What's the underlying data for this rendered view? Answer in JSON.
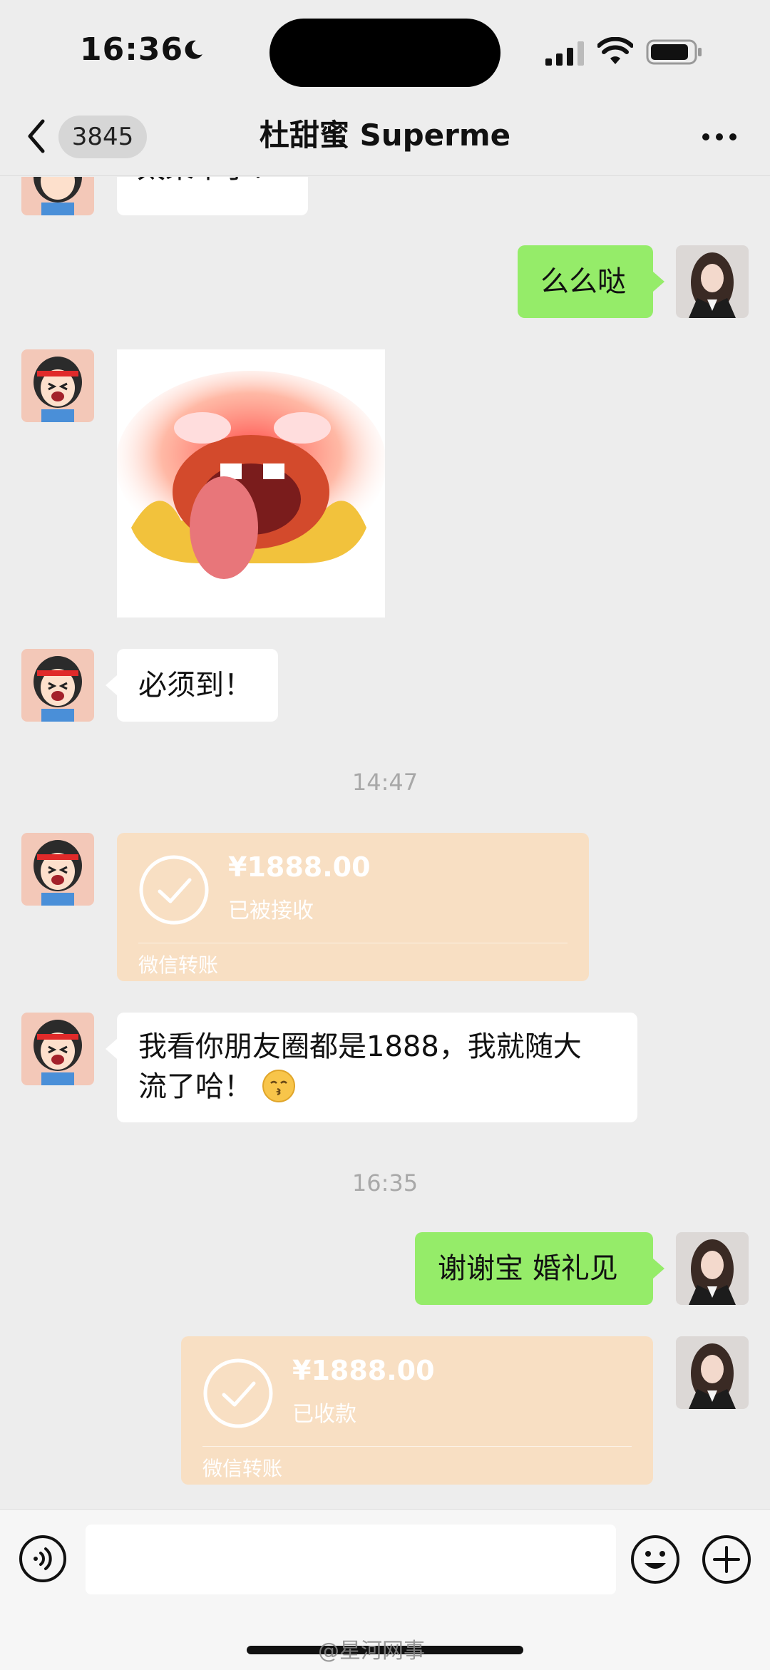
{
  "status_bar": {
    "time": "16:36"
  },
  "header": {
    "back_badge": "3845",
    "title": "杜甜蜜 Superme"
  },
  "messages": {
    "m0": {
      "text": "太呆辜了！"
    },
    "m1": {
      "text": "么么哒"
    },
    "m3": {
      "text": "必须到！"
    },
    "t1": {
      "text": "14:47"
    },
    "m4": {
      "amount": "¥1888.00",
      "status": "已被接收",
      "footer": "微信转账"
    },
    "m5": {
      "line1": "我看你朋友圈都是1888，我就随大",
      "line2": "流了哈！"
    },
    "t2": {
      "text": "16:35"
    },
    "m6": {
      "text": "谢谢宝 婚礼见"
    },
    "m7": {
      "amount": "¥1888.00",
      "status": "已收款",
      "footer": "微信转账"
    }
  },
  "watermark": "@星河网事",
  "icons": {
    "back": "chevron-left-icon",
    "more": "more-icon",
    "voice": "voice-icon",
    "emoji": "emoji-icon",
    "plus": "plus-icon",
    "check": "check-circle-icon"
  },
  "colors": {
    "background": "#ededed",
    "own_bubble": "#95ec69",
    "other_bubble": "#ffffff",
    "transfer_card": "#f8dfc3"
  }
}
